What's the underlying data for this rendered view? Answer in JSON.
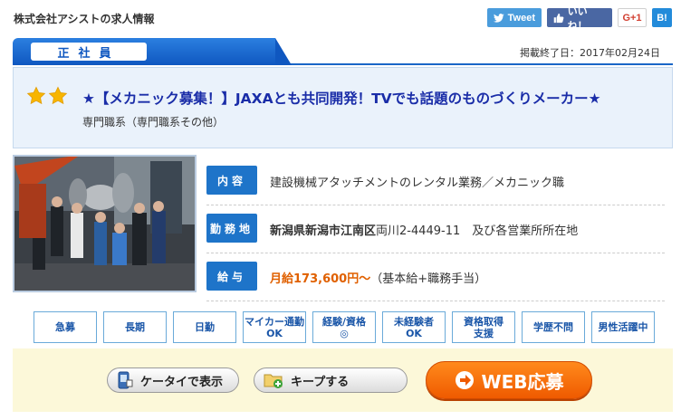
{
  "header": {
    "company": "株式会社アシストの求人情報",
    "employment_type": "正社員",
    "end_date": "掲載終了日：2017年02月24日"
  },
  "social": {
    "tweet": "Tweet",
    "like": "いいね！",
    "gplus": "G+1",
    "hatena": "B!"
  },
  "job": {
    "title": "★【メカニック募集！】JAXAとも共同開発！TVでも話題のものづくりメーカー★",
    "category": "専門職系（専門職系その他）",
    "star_count": 2
  },
  "details": [
    {
      "label": "内容",
      "value": "建設機械アタッチメントのレンタル業務／メカニック職",
      "style": "plain"
    },
    {
      "label": "勤務地",
      "value_main": "新潟県新潟市江南区",
      "value_rest": "両川2-4449-11　及び各営業所所在地",
      "style": "loc"
    },
    {
      "label": "給与",
      "value_main": "月給173,600円～",
      "value_rest": "（基本給+職務手当）",
      "style": "sal"
    }
  ],
  "tags": [
    [
      "急募"
    ],
    [
      "長期"
    ],
    [
      "日勤"
    ],
    [
      "マイカー通勤",
      "OK"
    ],
    [
      "経験/資格",
      "◎"
    ],
    [
      "未経験者",
      "OK"
    ],
    [
      "資格取得",
      "支援"
    ],
    [
      "学歴不問"
    ],
    [
      "男性活躍中"
    ]
  ],
  "actions": {
    "mobile": "ケータイで表示",
    "keep": "キープする",
    "apply": "WEB応募"
  },
  "colors": {
    "brand_blue": "#1e74c9",
    "title_blue": "#1a2da8",
    "salary_orange": "#e06000",
    "apply_orange": "#ff8a1c",
    "action_bg": "#fcf8d9"
  }
}
